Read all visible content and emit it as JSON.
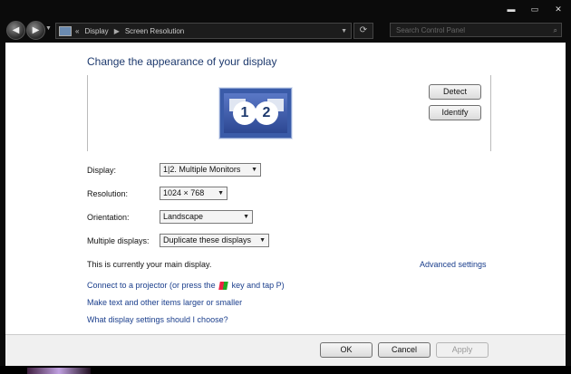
{
  "window": {
    "controls": {
      "minimize": "▬",
      "maximize": "▭",
      "close": "✕"
    }
  },
  "nav": {
    "back_icon": "arrow-left-icon",
    "forward_icon": "arrow-right-icon",
    "address": {
      "crumbs": [
        "«",
        "Display",
        "Screen Resolution"
      ],
      "separator": "▶"
    },
    "search_placeholder": "Search Control Panel"
  },
  "main": {
    "heading": "Change the appearance of your display",
    "monitor": {
      "numbers": [
        "1",
        "2"
      ]
    },
    "detect_label": "Detect",
    "identify_label": "Identify",
    "fields": [
      {
        "label": "Display:",
        "value": "1|2. Multiple Monitors"
      },
      {
        "label": "Resolution:",
        "value": "1024 × 768"
      },
      {
        "label": "Orientation:",
        "value": "Landscape"
      },
      {
        "label": "Multiple displays:",
        "value": "Duplicate these displays"
      }
    ],
    "main_display_text": "This is currently your main display.",
    "advanced_link": "Advanced settings",
    "projector_link": "Connect to a projector (or press the",
    "projector_link_end": "key and tap P)",
    "text_size_link": "Make text and other items larger or smaller",
    "help_link": "What display settings should I choose?"
  },
  "footer": {
    "ok": "OK",
    "cancel": "Cancel",
    "apply": "Apply"
  }
}
